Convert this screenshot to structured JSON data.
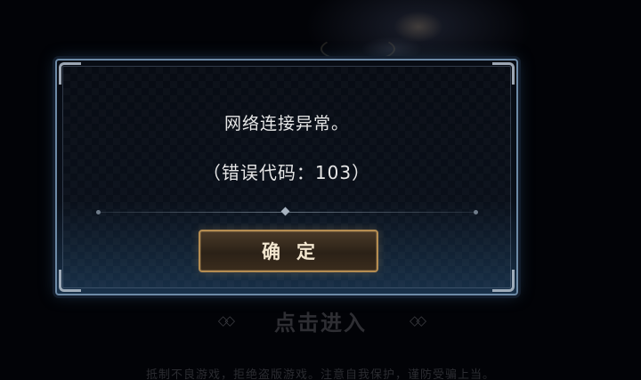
{
  "background": {
    "enter_button_label": "点击进入",
    "enter_left_ornament": "◇◇",
    "enter_right_ornament": "◇◇",
    "notice_text": "抵制不良游戏，拒绝盗版游戏。注意自我保护，谨防受骗上当。"
  },
  "dialog": {
    "message": "网络连接异常。",
    "error_code": "（错误代码：103）",
    "confirm_label": "确定"
  },
  "colors": {
    "dialog_border": "#6d8aa6",
    "button_border": "#b58d52",
    "text": "#e6e6e6"
  }
}
